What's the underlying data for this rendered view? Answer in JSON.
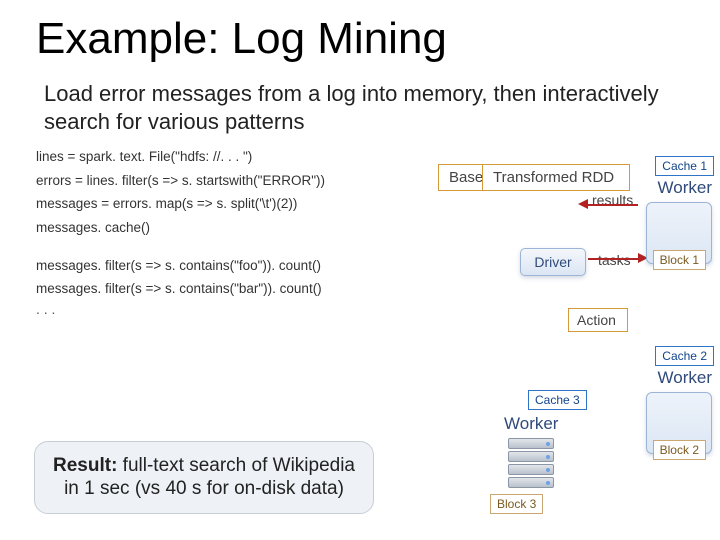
{
  "title": "Example: Log Mining",
  "subtitle": "Load error messages from a log into memory, then interactively search for various patterns",
  "code": {
    "l1": "lines = spark. text. File(\"hdfs: //. . . \")",
    "l2": "errors = lines. filter(s => s. startswith(\"ERROR\"))",
    "l3": "messages = errors. map(s => s. split('\\t')(2))",
    "l4": "messages. cache()",
    "l5": "messages. filter(s => s. contains(\"foo\")). count()",
    "l6": "messages. filter(s => s. contains(\"bar\")). count()",
    "ellipsis": ". . ."
  },
  "result": {
    "prefix": "Result:",
    "rest": " full-text search of Wikipedia in 1 sec (vs 40 s for on-disk data)"
  },
  "diagram": {
    "base_callout": "Base",
    "trans_callout": "Transformed RDD",
    "action_callout": "Action",
    "results_label": "results",
    "tasks_label": "tasks",
    "driver": "Driver",
    "worker_label": "Worker",
    "cache1": "Cache 1",
    "cache2": "Cache 2",
    "cache3": "Cache 3",
    "block1": "Block 1",
    "block2": "Block 2",
    "block3": "Block 3"
  }
}
